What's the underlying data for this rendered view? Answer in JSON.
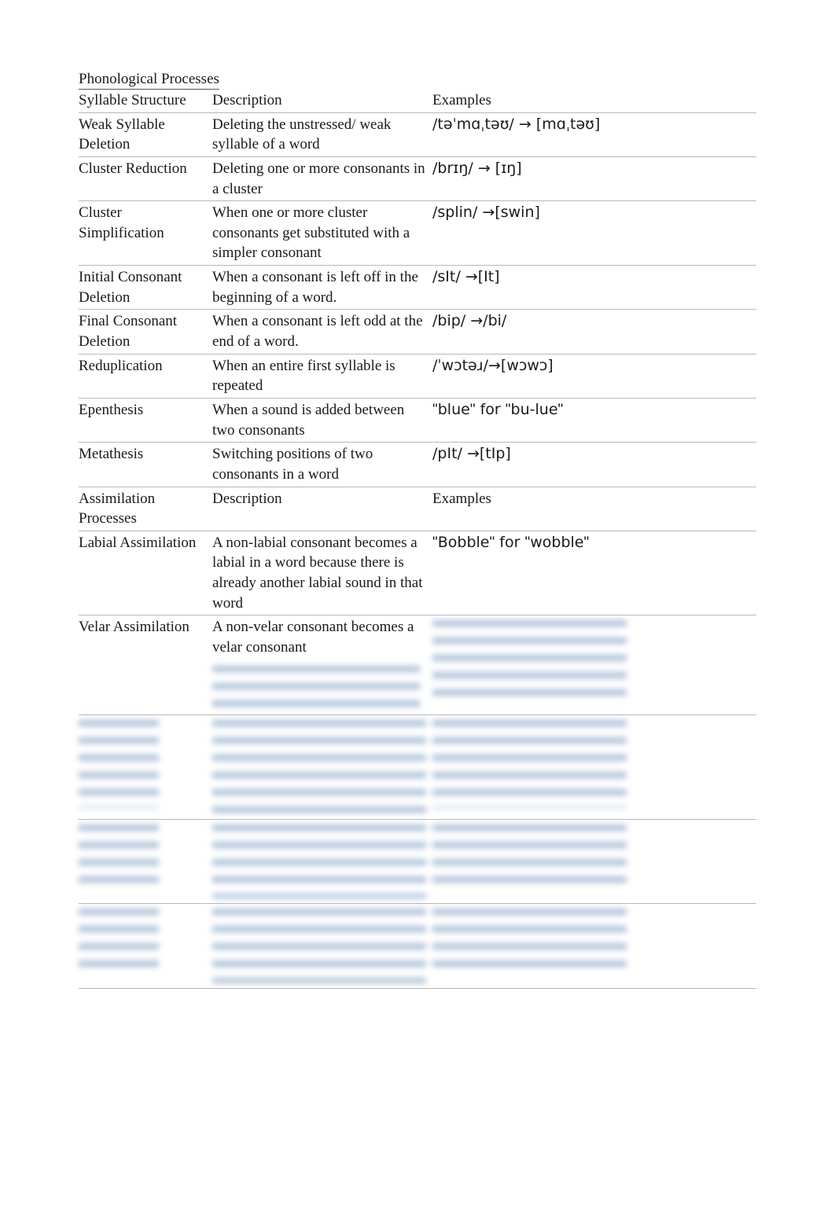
{
  "title": "Phonological Processes",
  "sections": [
    {
      "header": {
        "col1": "Syllable Structure",
        "col2": "Description",
        "col3": "Examples"
      },
      "rows": [
        {
          "term": "Weak Syllable Deletion",
          "desc": "Deleting the unstressed/ weak syllable of a word",
          "example": "/təˈmɑˌtəʊ/ → [mɑˌtəʊ]"
        },
        {
          "term": "Cluster Reduction",
          "desc": "Deleting one or more consonants in a cluster",
          "example": "/brɪŋ/ → [ɪŋ]"
        },
        {
          "term": "Cluster Simplification",
          "desc": "When one or more cluster consonants get substituted with a simpler consonant",
          "example": "/splin/ →[swin]"
        },
        {
          "term": "Initial Consonant Deletion",
          "desc": "When a consonant is left off in the beginning of a word.",
          "example": "/sIt/ →[It]"
        },
        {
          "term": "Final Consonant Deletion",
          "desc": "When a consonant is left odd at the end of a word.",
          "example": "/bip/ →/bi/"
        },
        {
          "term": "Reduplication",
          "desc": "When an entire first syllable is repeated",
          "example": "/ˈwɔtəɹ/→[wɔwɔ]"
        },
        {
          "term": "Epenthesis",
          "desc": "When a sound is added between two consonants",
          "example": "\"blue\" for \"bu-lue\""
        },
        {
          "term": "Metathesis",
          "desc": "Switching positions of two consonants in a word",
          "example": "/pIt/ →[tIp]"
        }
      ]
    },
    {
      "header": {
        "col1": "Assimilation Processes",
        "col2": "Description",
        "col3": "Examples"
      },
      "rows": [
        {
          "term": "Labial Assimilation",
          "desc": "A non-labial consonant becomes a labial in a word because there is already another labial sound in that word",
          "example": "\"Bobble\" for \"wobble\""
        },
        {
          "term": "Velar Assimilation",
          "desc": "A non-velar consonant becomes a velar consonant",
          "desc_hidden_lines": 3,
          "example_hidden": true
        },
        {
          "term_hidden": true,
          "desc_hidden_lines": 5,
          "example_hidden": true
        },
        {
          "term_hidden": true,
          "desc_hidden_lines": 4,
          "example_hidden": true
        },
        {
          "term_hidden": true,
          "desc_hidden_lines": 4,
          "example_hidden": true
        }
      ]
    }
  ]
}
